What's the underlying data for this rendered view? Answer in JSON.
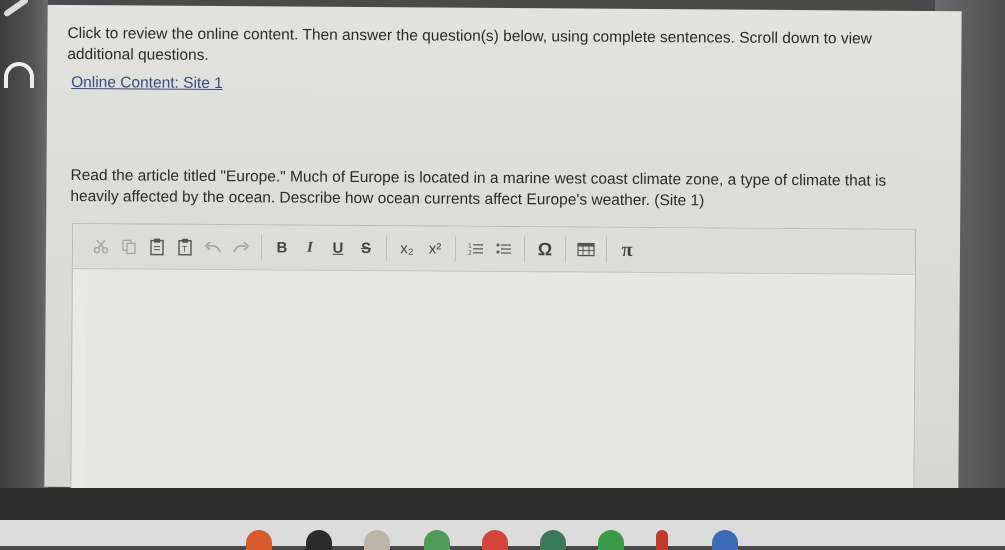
{
  "instructions": "Click to review the online content. Then answer the question(s) below, using complete sentences. Scroll down to view additional questions.",
  "online_content_link": "Online Content: Site 1",
  "question": "Read the article titled \"Europe.\" Much of Europe is located in a marine west coast climate zone, a type of climate that is heavily affected by the ocean. Describe how ocean currents affect Europe's weather. (Site 1)",
  "toolbar": {
    "cut_icon": "cut-icon",
    "copy_icon": "copy-icon",
    "paste_icon": "paste-icon",
    "paste_text_icon": "paste-text-icon",
    "undo_icon": "undo-icon",
    "redo_icon": "redo-icon",
    "bold": "B",
    "italic": "I",
    "underline": "U",
    "strike": "S",
    "subscript": "x₂",
    "superscript": "x²",
    "ordered_list_icon": "ordered-list-icon",
    "bullet_list_icon": "bullet-list-icon",
    "omega": "Ω",
    "table_icon": "table-icon",
    "pi": "π"
  },
  "colors": {
    "link": "#3a4f7a",
    "page_bg": "#dedede",
    "text": "#2a2a2a"
  }
}
